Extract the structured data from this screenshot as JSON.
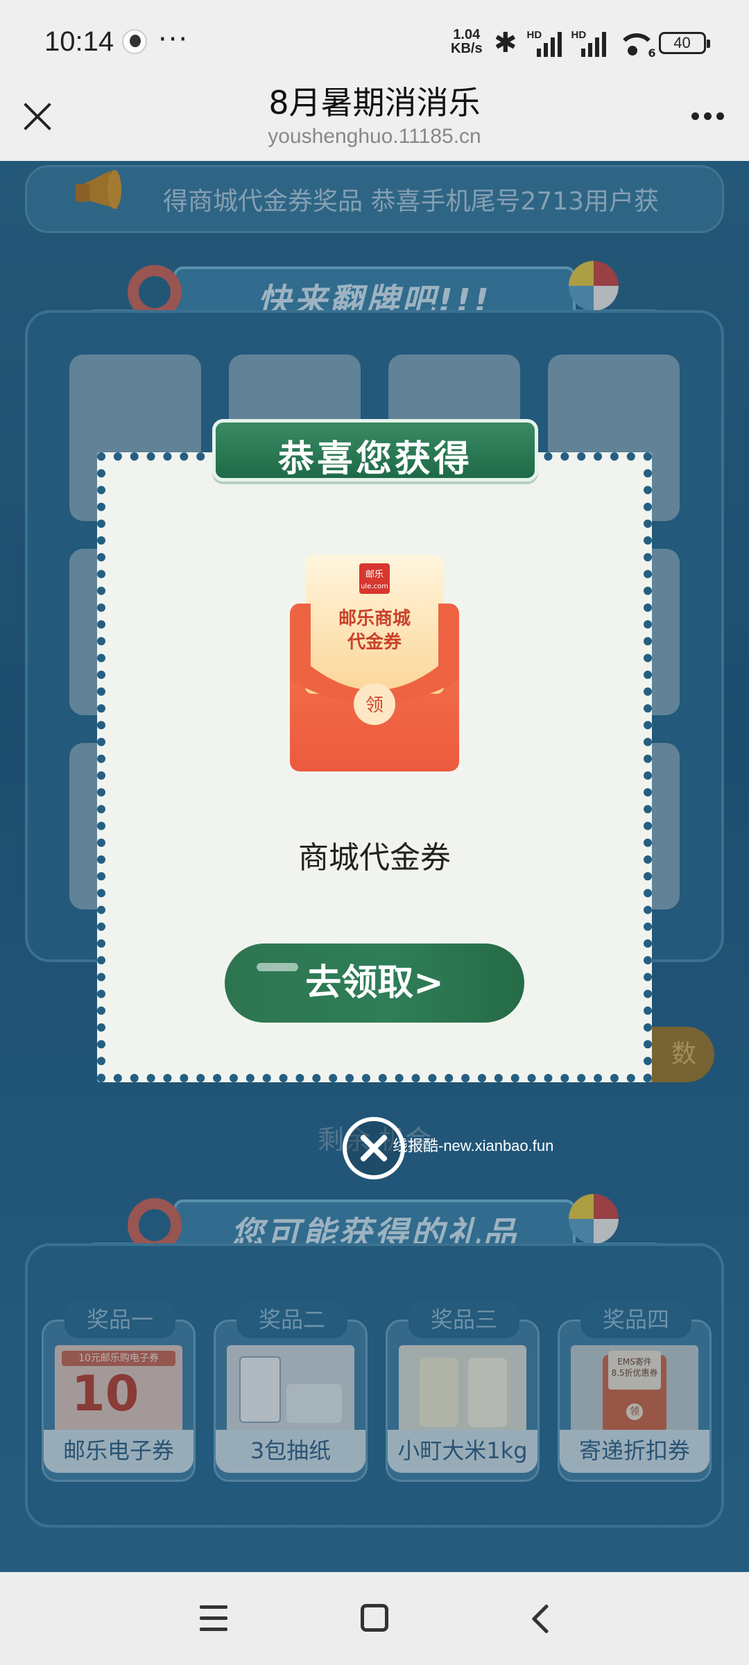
{
  "status_bar": {
    "time": "10:14",
    "dots": "···",
    "net_speed_value": "1.04",
    "net_speed_unit": "KB/s",
    "sim1": "HD",
    "sim2": "HD",
    "wifi_badge": "6",
    "battery": "40"
  },
  "browser": {
    "title": "8月暑期消消乐",
    "url": "youshenghuo.11185.cn"
  },
  "page": {
    "notice": "得商城代金券奖品    恭喜手机尾号2713用户获",
    "game_banner": "快来翻牌吧!!!",
    "more_chances": "数",
    "chances_left": "剩余        机会",
    "gifts_banner": "您可能获得的礼品",
    "gifts": [
      {
        "tab": "奖品一",
        "name": "邮乐电子券"
      },
      {
        "tab": "奖品二",
        "name": "3包抽纸"
      },
      {
        "tab": "奖品三",
        "name": "小町大米1kg"
      },
      {
        "tab": "奖品四",
        "name": "寄递折扣券"
      }
    ],
    "gift_texts": {
      "coupon_title": "10元邮乐购电子券",
      "coupon_value": "10",
      "ems_line1": "EMS寄件",
      "ems_line2": "8.5折优惠券",
      "ems_mark": "领"
    }
  },
  "modal": {
    "header": "恭喜您获得",
    "envelope": {
      "logo_line1": "邮乐",
      "logo_line2": "ule.com",
      "line1": "邮乐商城",
      "line2": "代金券",
      "badge": "领"
    },
    "prize_name": "商城代金券",
    "claim_button": "去领取>",
    "watermark": "线报酷-new.xianbao.fun"
  },
  "colors": {
    "primary_green": "#2d7550",
    "page_blue": "#245d83",
    "envelope_red": "#ea5c3a"
  }
}
